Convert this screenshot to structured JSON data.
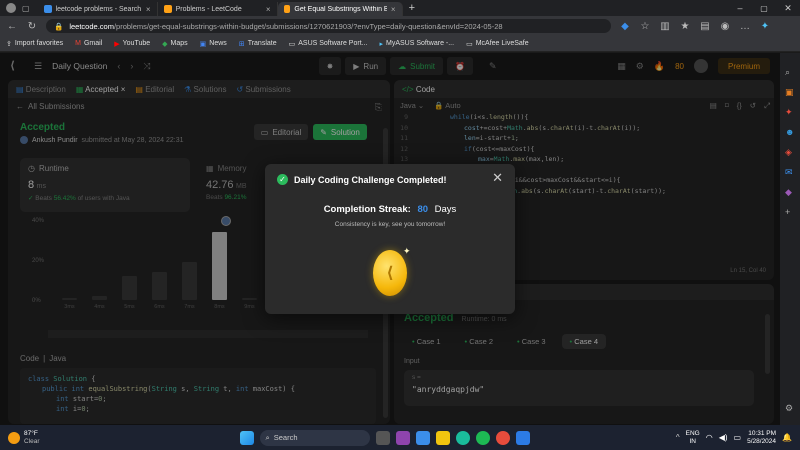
{
  "browser": {
    "tabs": [
      {
        "label": "leetcode problems - Search",
        "active": false
      },
      {
        "label": "Problems - LeetCode",
        "active": false
      },
      {
        "label": "Get Equal Substrings Within Bud...",
        "active": true
      }
    ],
    "url_host": "leetcode.com",
    "url_path": "/problems/get-equal-substrings-within-budget/submissions/1270621903/?envType=daily-question&envId=2024-05-28",
    "favorites": [
      "Import favorites",
      "Gmail",
      "YouTube",
      "Maps",
      "News",
      "Translate",
      "ASUS Software Port...",
      "MyASUS Software -...",
      "McAfee LiveSafe"
    ]
  },
  "lc_top": {
    "daily_label": "Daily Question",
    "run_label": "Run",
    "submit_label": "Submit",
    "coins": "80",
    "premium_label": "Premium"
  },
  "left_panel": {
    "tabs": [
      "Description",
      "Accepted",
      "Editorial",
      "Solutions",
      "Submissions"
    ],
    "back_label": "All Submissions",
    "status": "Accepted",
    "user": "Ankush Pundir",
    "submitted": "submitted at May 28, 2024 22:31",
    "editorial_btn": "Editorial",
    "solution_btn": "Solution",
    "runtime_label": "Runtime",
    "runtime_value": "8",
    "runtime_unit": "ms",
    "runtime_beats_prefix": "Beats",
    "runtime_beats": "56.42%",
    "runtime_beats_suffix": "of users with Java",
    "memory_label": "Memory",
    "memory_value": "42.76",
    "memory_unit": "MB",
    "memory_beats_prefix": "Beats",
    "memory_beats": "96.21%",
    "code_label": "Code",
    "code_lang": "Java",
    "code_lines": [
      {
        "t": "class Solution {"
      },
      {
        "t": "public int equalSubstring(String s, String t, int maxCost) {"
      },
      {
        "t": "int start=0;"
      },
      {
        "t": "int i=0;"
      }
    ]
  },
  "chart_data": {
    "type": "bar",
    "categories": [
      "3ms",
      "4ms",
      "5ms",
      "6ms",
      "7ms",
      "8ms",
      "9ms"
    ],
    "values": [
      1,
      2,
      12,
      14,
      19,
      34,
      1
    ],
    "yticks": [
      "40%",
      "20%",
      "0%"
    ],
    "ylim": [
      0,
      40
    ],
    "highlight_index": 5
  },
  "right_panel": {
    "code_tab": "Code",
    "lang": "Java",
    "auto": "Auto",
    "line_numbers": [
      "9",
      "10",
      "11",
      "12",
      "13",
      "14",
      "15",
      "16"
    ],
    "code_lines": [
      "while(i<s.length()){",
      "cost+=cost+Math.abs(s.charAt(i)-t.charAt(i));",
      "len=i-start+1;",
      "if(cost<=maxCost){",
      "max=Math.max(max,len);",
      "}",
      "while(start<=i&&cost>maxCost&&start<=i){",
      "cost-=Math.abs(s.charAt(start)-t.charAt(start));"
    ],
    "cursor_pos": "Ln 15, Col 40",
    "accepted": "Accepted",
    "runtime": "Runtime: 0 ms",
    "cases": [
      "Case 1",
      "Case 2",
      "Case 3",
      "Case 4"
    ],
    "input_label": "Input",
    "input_var": "s =",
    "input_value": "\"anryddgaqpjdw\""
  },
  "modal": {
    "title": "Daily Coding Challenge Completed!",
    "streak_label": "Completion Streak:",
    "streak_value": "80",
    "streak_unit": "Days",
    "message": "Consistency is key, see you tomorrow!"
  },
  "taskbar": {
    "temp": "87°F",
    "weather": "Clear",
    "search": "Search",
    "lang1": "ENG",
    "lang2": "IN",
    "time": "10:31 PM",
    "date": "5/28/2024"
  }
}
